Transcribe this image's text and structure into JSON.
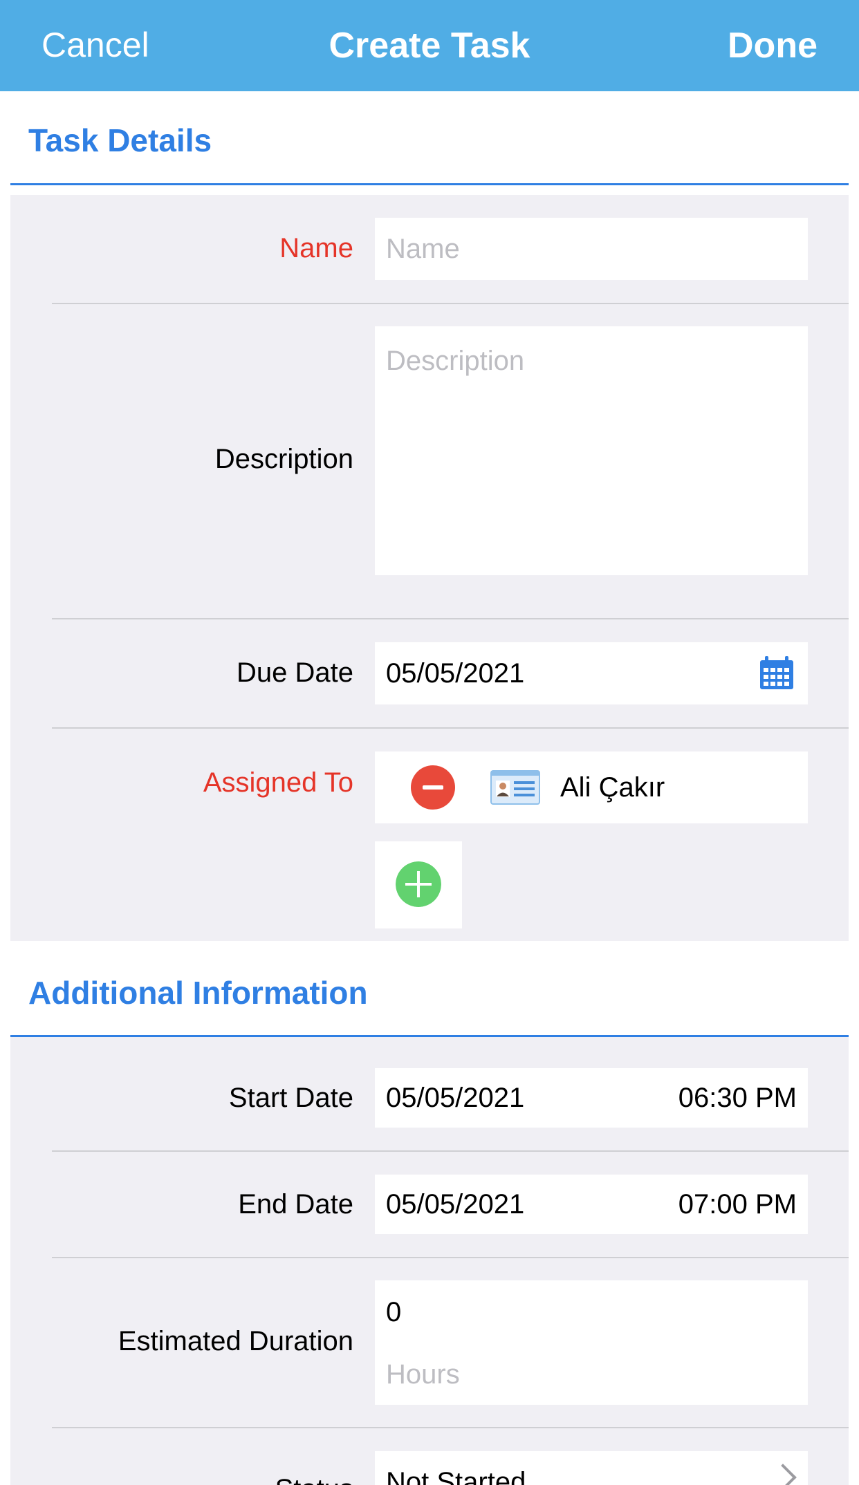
{
  "navbar": {
    "cancel_label": "Cancel",
    "title": "Create Task",
    "done_label": "Done",
    "background_color": "#50ADE5"
  },
  "task_details": {
    "section_title": "Task Details",
    "name": {
      "label": "Name",
      "placeholder": "Name",
      "value": "",
      "required": true
    },
    "description": {
      "label": "Description",
      "placeholder": "Description",
      "value": ""
    },
    "due_date": {
      "label": "Due Date",
      "value": "05/05/2021",
      "icon": "calendar-icon"
    },
    "assigned_to": {
      "label": "Assigned To",
      "required": true,
      "assignee": {
        "name": "Ali Çakır",
        "icon": "contact-card-icon",
        "remove_icon": "minus-circle-icon"
      },
      "add_icon": "plus-circle-icon"
    }
  },
  "additional_info": {
    "section_title": "Additional Information",
    "start_date": {
      "label": "Start Date",
      "date": "05/05/2021",
      "time": "06:30 PM"
    },
    "end_date": {
      "label": "End Date",
      "date": "05/05/2021",
      "time": "07:00 PM"
    },
    "estimated_duration": {
      "label": "Estimated Duration",
      "value": "0",
      "unit": "Hours"
    },
    "status": {
      "label": "Status",
      "value": "Not Started",
      "icon": "chevron-right-icon"
    }
  },
  "colors": {
    "accent": "#2F7FE3",
    "required_label": "#E53428",
    "remove": "#E8493A",
    "add": "#62D26F",
    "form_background": "#F0EFF4"
  }
}
